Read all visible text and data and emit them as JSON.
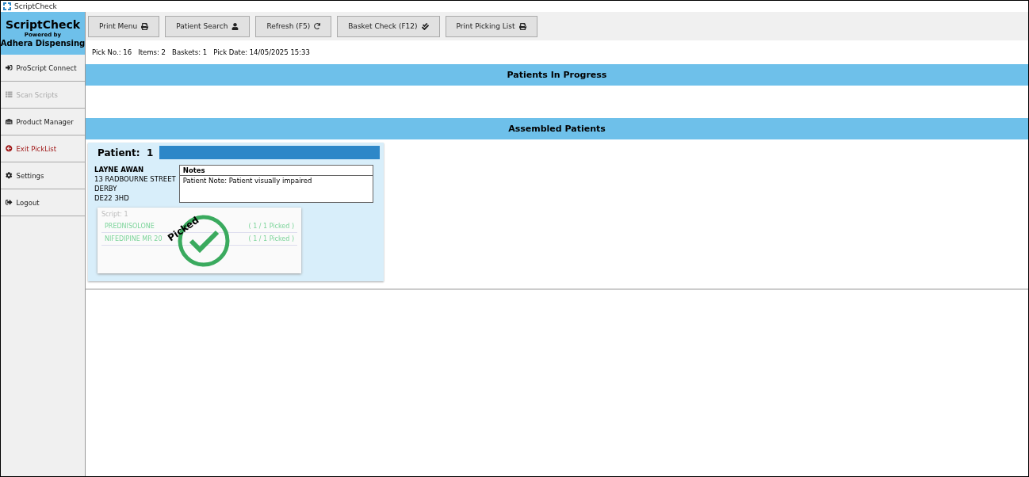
{
  "window": {
    "title": "ScriptCheck"
  },
  "brand": {
    "name": "ScriptCheck",
    "tagline": "Powered by",
    "company": "Adhera Dispensing"
  },
  "sidebar": {
    "items": [
      {
        "kind": "connect",
        "label": "ProScript Connect",
        "disabled": false
      },
      {
        "kind": "scan",
        "label": "Scan Scripts",
        "disabled": true
      },
      {
        "kind": "product",
        "label": "Product Manager",
        "disabled": false
      },
      {
        "kind": "exit",
        "label": "Exit PickList",
        "disabled": false
      },
      {
        "kind": "settings",
        "label": "Settings",
        "disabled": false
      },
      {
        "kind": "logout",
        "label": "Logout",
        "disabled": false
      }
    ]
  },
  "toolbar": [
    {
      "kind": "print",
      "label": "Print Menu"
    },
    {
      "kind": "user",
      "label": "Patient Search"
    },
    {
      "kind": "refresh",
      "label": "Refresh (F5)"
    },
    {
      "kind": "check",
      "label": "Basket Check (F12)"
    },
    {
      "kind": "print",
      "label": "Print Picking List"
    }
  ],
  "pick_info": "Pick No.: 16   Items: 2   Baskets: 1   Pick Date: 14/05/2025 15:33",
  "sections": [
    {
      "title": "Patients In Progress"
    },
    {
      "title": "Assembled Patients",
      "patients": [
        {
          "heading": "Patient:  1",
          "name": "LAYNE AWAN",
          "address": [
            "13 RADBOURNE STREET",
            "DERBY",
            "DE22 3HD"
          ],
          "notes_title": "Notes",
          "note": "Patient Note:  Patient visually impaired",
          "script": {
            "title": "Script: 1",
            "picked": true,
            "stamp": "Picked",
            "items": [
              {
                "name": "PREDNISOLONE",
                "status": "( 1 / 1 Picked )"
              },
              {
                "name": "NIFEDIPINE MR 20",
                "status": "( 1 / 1 Picked )"
              }
            ]
          }
        }
      ]
    }
  ]
}
